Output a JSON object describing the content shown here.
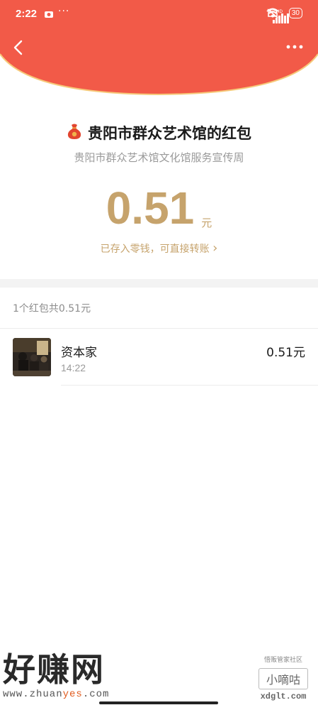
{
  "status_bar": {
    "time": "2:22",
    "more_dots": "···",
    "net1": "HD",
    "net2": "HD",
    "battery": "30"
  },
  "header": {
    "color": "#f25a48",
    "back_icon": "chevron-left-icon",
    "more_icon": "more-dots-icon"
  },
  "packet": {
    "title": "贵阳市群众艺术馆的红包",
    "subtitle": "贵阳市群众艺术馆文化馆服务宣传周",
    "amount": "0.51",
    "unit": "元",
    "saved_text": "已存入零钱，可直接转账",
    "saved_arrow": "›",
    "accent": "#c6a36c"
  },
  "summary": "1个红包共0.51元",
  "recipients": [
    {
      "name": "资本家",
      "time": "14:22",
      "amount": "0.51元"
    }
  ],
  "watermark_left": {
    "big": "好赚网",
    "url_a": "www.zhuan",
    "url_b": "yes",
    "url_c": ".com"
  },
  "watermark_right": {
    "small": "悟贩管家社区",
    "box": "小嘀咕",
    "site": "xdglt.com"
  }
}
